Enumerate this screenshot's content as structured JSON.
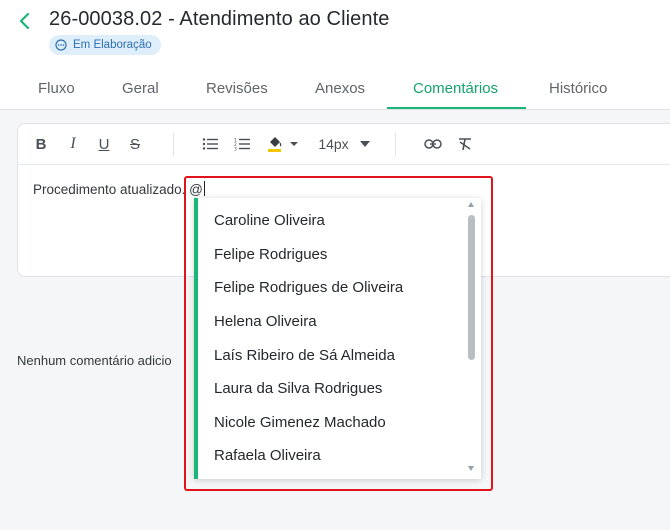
{
  "header": {
    "title": "26-00038.02 - Atendimento ao Cliente",
    "status_badge": "Em Elaboração"
  },
  "tabs": [
    {
      "label": "Fluxo"
    },
    {
      "label": "Geral"
    },
    {
      "label": "Revisões"
    },
    {
      "label": "Anexos"
    },
    {
      "label": "Comentários",
      "active": true
    },
    {
      "label": "Histórico"
    }
  ],
  "editor": {
    "toolbar": {
      "bold": "B",
      "italic": "I",
      "underline": "U",
      "strike": "S",
      "font_size": "14px"
    },
    "content": "Procedimento atualizado. @"
  },
  "comments": {
    "empty_text": "Nenhum comentário adicio"
  },
  "mention_dropdown": {
    "items": [
      "Caroline Oliveira",
      "Felipe Rodrigues",
      "Felipe Rodrigues de Oliveira",
      "Helena Oliveira",
      "Laís Ribeiro de Sá Almeida",
      "Laura da Silva Rodrigues",
      "Nicole Gimenez Machado",
      "Rafaela Oliveira"
    ]
  },
  "colors": {
    "accent": "#1bb57a",
    "highlight": "#e0141b",
    "badge_bg": "#dfeefb",
    "badge_text": "#2c6fb3"
  }
}
